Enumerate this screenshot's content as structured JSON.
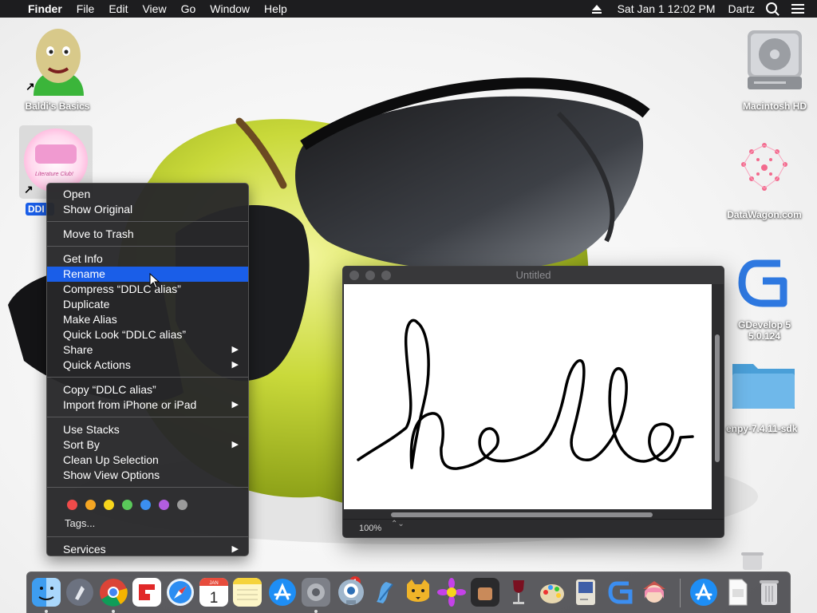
{
  "menubar": {
    "apple": "",
    "app_name": "Finder",
    "menus": [
      "File",
      "Edit",
      "View",
      "Go",
      "Window",
      "Help"
    ],
    "datetime": "Sat Jan 1  12:02 PM",
    "user": "Dartz"
  },
  "desktop": {
    "baldi_label": "Baldi's Basics",
    "ddlc_label": "DDLC alias",
    "ddlc_label_visible": "DDI",
    "ddlc_logo_text": "Literature Club!",
    "macintosh_label": "Macintosh HD",
    "datawagon_label": "DataWagon.com",
    "gdevelop_label_line1": "GDevelop 5",
    "gdevelop_label_line2": "5.0.124",
    "renpy_label": "enpy-7.4.11-sdk"
  },
  "context_menu": {
    "items": [
      {
        "label": "Open"
      },
      {
        "label": "Show Original"
      },
      {
        "label": "Move to Trash"
      },
      {
        "label": "Get Info"
      },
      {
        "label": "Rename",
        "selected": true
      },
      {
        "label": "Compress “DDLC alias”"
      },
      {
        "label": "Duplicate"
      },
      {
        "label": "Make Alias"
      },
      {
        "label": "Quick Look “DDLC alias”"
      },
      {
        "label": "Share",
        "submenu": true
      },
      {
        "label": "Quick Actions",
        "submenu": true
      },
      {
        "label": "Copy “DDLC alias”"
      },
      {
        "label": "Import from iPhone or iPad",
        "submenu": true
      },
      {
        "label": "Use Stacks"
      },
      {
        "label": "Sort By",
        "submenu": true
      },
      {
        "label": "Clean Up Selection"
      },
      {
        "label": "Show View Options"
      },
      {
        "label": "Tags..."
      },
      {
        "label": "Services",
        "submenu": true
      }
    ],
    "tag_colors": [
      "#f04b4a",
      "#f5a623",
      "#f7d51c",
      "#5ac85a",
      "#3b8ff0",
      "#b25de0",
      "#9b9b9b"
    ],
    "submenu_arrow": "▶"
  },
  "preview_window": {
    "title": "Untitled",
    "zoom": "100%",
    "zoom_stepper": "⌃⌄",
    "drawing_text": "hello"
  },
  "dock": {
    "badge": "1",
    "calendar_month": "JAN",
    "calendar_day": "1"
  }
}
